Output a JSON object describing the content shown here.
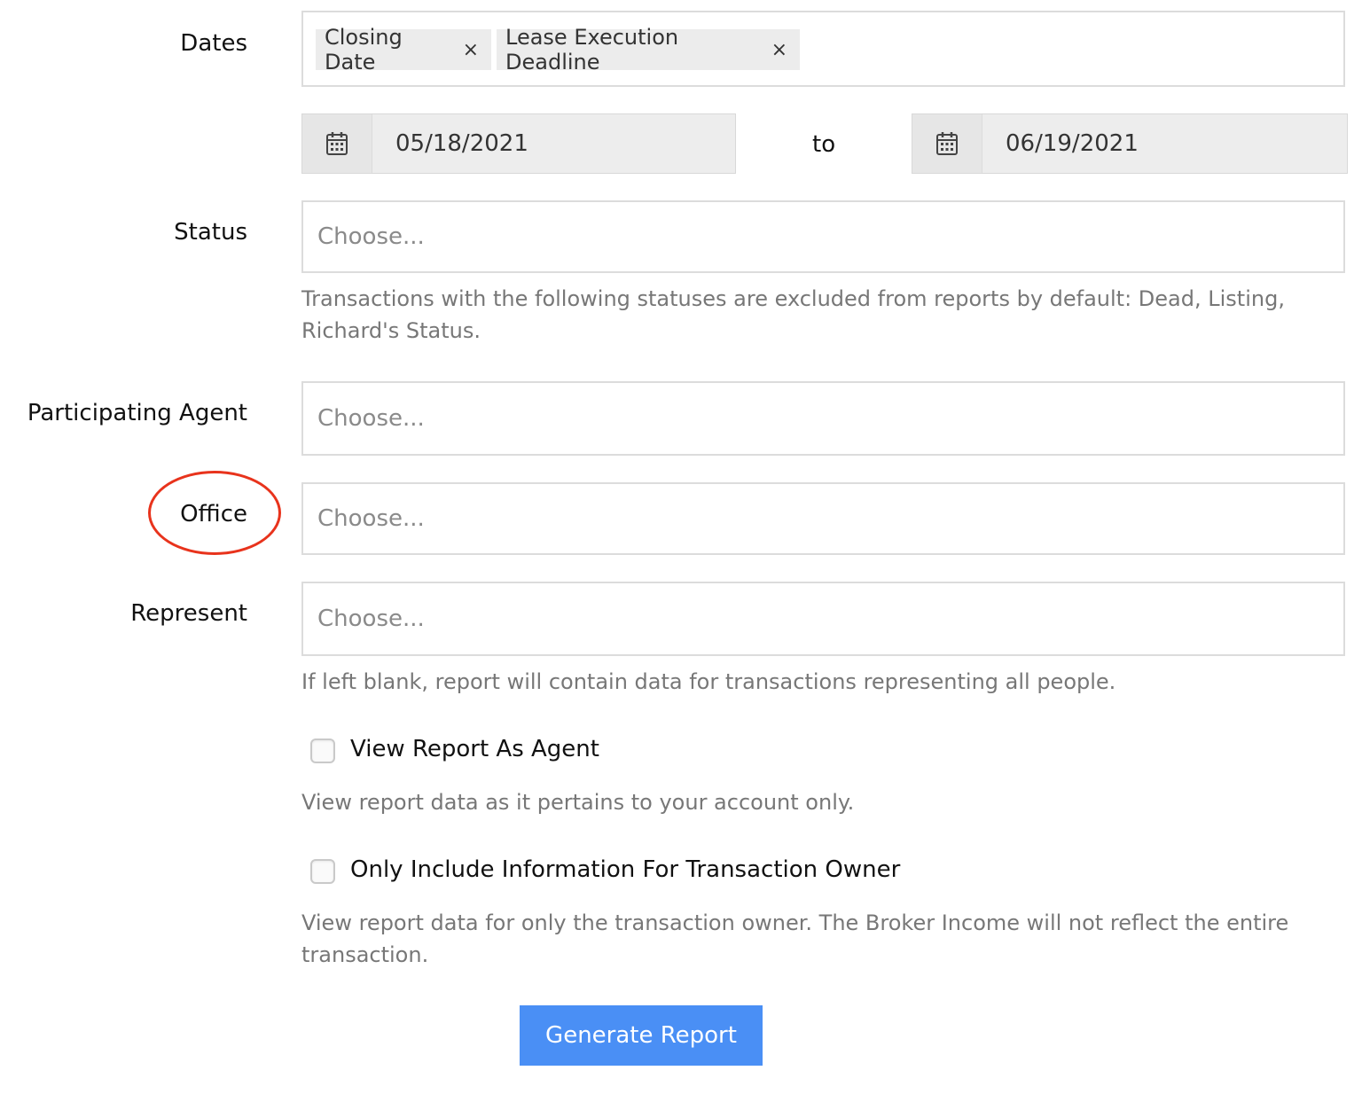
{
  "colors": {
    "accent": "#4a8ff5",
    "annotation": "#e8331c",
    "chip_bg": "#ececec",
    "help_text": "#777777"
  },
  "dates": {
    "label": "Dates",
    "chips": [
      {
        "label": "Closing Date",
        "remove_glyph": "×"
      },
      {
        "label": "Lease Execution Deadline",
        "remove_glyph": "×"
      }
    ],
    "start_date": "05/18/2021",
    "range_separator": "to",
    "end_date": "06/19/2021",
    "date_icon": "calendar-icon"
  },
  "status": {
    "label": "Status",
    "placeholder": "Choose...",
    "help": "Transactions with the following statuses are excluded from reports by default: Dead, Listing, Richard's Status."
  },
  "participating_agent": {
    "label": "Participating Agent",
    "placeholder": "Choose..."
  },
  "office": {
    "label": "Office",
    "placeholder": "Choose...",
    "highlighted": true
  },
  "represent": {
    "label": "Represent",
    "placeholder": "Choose...",
    "help": "If left blank, report will contain data for transactions representing all people."
  },
  "view_as_agent": {
    "label": "View Report As Agent",
    "checked": false,
    "help": "View report data as it pertains to your account only."
  },
  "owner_only": {
    "label": "Only Include Information For Transaction Owner",
    "checked": false,
    "help": "View report data for only the transaction owner. The Broker Income will not reflect the entire transaction."
  },
  "generate_button": {
    "label": "Generate Report"
  }
}
